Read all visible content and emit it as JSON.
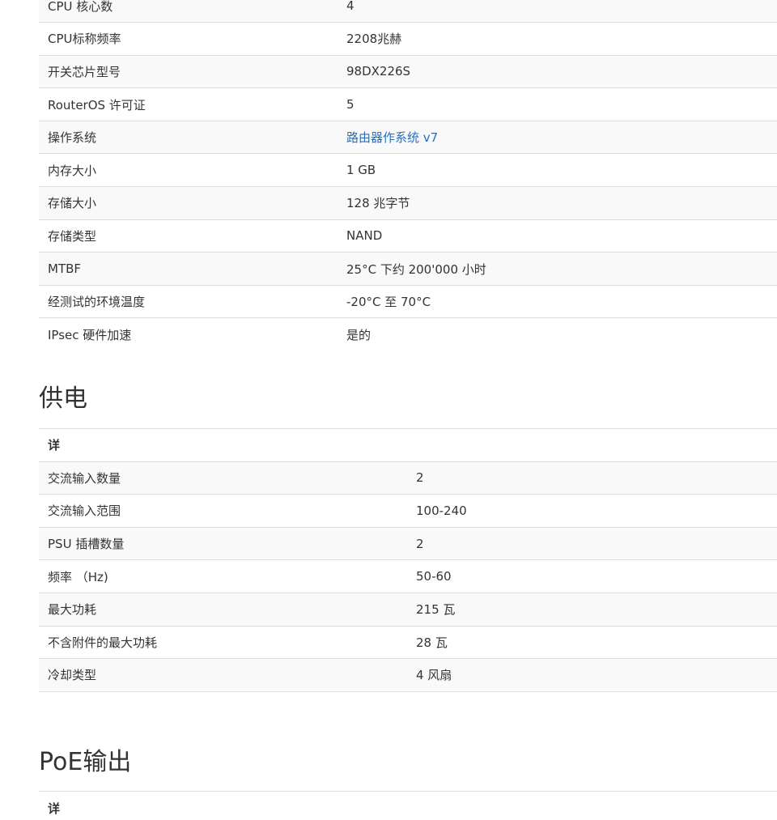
{
  "specs": {
    "rows": [
      {
        "label": "CPU 核心数",
        "value": "4"
      },
      {
        "label": "CPU标称频率",
        "value": "2208兆赫"
      },
      {
        "label": "开关芯片型号",
        "value": "98DX226S"
      },
      {
        "label": "RouterOS 许可证",
        "value": "5"
      },
      {
        "label": "操作系统",
        "value": "路由器作系统 v7"
      },
      {
        "label": "内存大小",
        "value": "1 GB"
      },
      {
        "label": "存储大小",
        "value": "128 兆字节"
      },
      {
        "label": "存储类型",
        "value": "NAND"
      },
      {
        "label": "MTBF",
        "value": "25°C 下约 200'000 小时"
      },
      {
        "label": "经测试的环境温度",
        "value": "-20°C 至 70°C"
      },
      {
        "label": "IPsec 硬件加速",
        "value": "是的"
      }
    ]
  },
  "power": {
    "heading": "供电",
    "header": "详",
    "rows": [
      {
        "label": "交流输入数量",
        "value": "2"
      },
      {
        "label": "交流输入范围",
        "value": "100-240"
      },
      {
        "label": "PSU 插槽数量",
        "value": "2"
      },
      {
        "label": "频率 （Hz)",
        "value": "50-60"
      },
      {
        "label": "最大功耗",
        "value": "215 瓦"
      },
      {
        "label": "不含附件的最大功耗",
        "value": "28 瓦"
      },
      {
        "label": "冷却类型",
        "value": "4 风扇"
      }
    ]
  },
  "poe": {
    "heading": "PoE输出",
    "header": "详"
  }
}
